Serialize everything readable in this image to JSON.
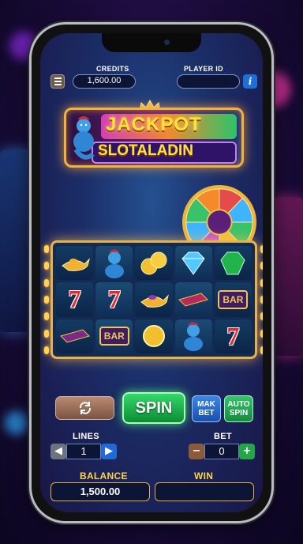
{
  "header": {
    "credits_label": "CREDITS",
    "credits_value": "1,600.00",
    "player_id_label": "PLAYER ID",
    "player_id_value": "",
    "menu_icon": "hamburger-menu-icon",
    "info_icon": "info-icon",
    "info_symbol": "i"
  },
  "banner": {
    "line1": "JACKPOT",
    "line2": "SLOTALADIN"
  },
  "reels": {
    "grid": [
      [
        "magic-lamp",
        "genie",
        "gold-coins",
        "diamond",
        "emerald"
      ],
      [
        "seven",
        "seven",
        "magic-lamp",
        "flying-carpet",
        "bar"
      ],
      [
        "flying-carpet",
        "bar",
        "gold-coins",
        "genie",
        "seven"
      ]
    ],
    "seven_text": "7",
    "bar_text": "BAR"
  },
  "controls": {
    "refresh_icon": "refresh-icon",
    "spin_label": "SPIN",
    "max_bet_label": [
      "MAK",
      "BET"
    ],
    "auto_spin_label": [
      "AUTO",
      "SPIN"
    ]
  },
  "lines": {
    "label": "LINES",
    "value": "1",
    "decrease": "◀",
    "increase": "▶"
  },
  "bet": {
    "label": "BET",
    "value": "0",
    "decrease": "−",
    "increase": "+"
  },
  "footer": {
    "balance_label": "BALANCE",
    "balance_value": "1,500.00",
    "win_label": "WIN",
    "win_value": ""
  },
  "colors": {
    "gold": "#e6b34b",
    "spin_green": "#1fb24a",
    "screen_blue": "#1b2d67"
  }
}
